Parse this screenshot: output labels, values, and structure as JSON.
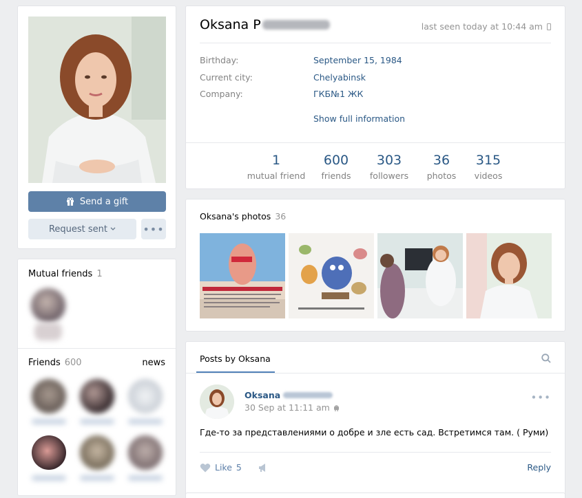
{
  "profile": {
    "name": "Oksana P",
    "last_seen": "last seen today at 10:44 am",
    "info": [
      {
        "label": "Birthday:",
        "value": "September 15, 1984"
      },
      {
        "label": "Current city:",
        "value": "Chelyabinsk"
      },
      {
        "label": "Company:",
        "value": "ГКБ№1 ЖК"
      }
    ],
    "show_full": "Show full information",
    "counters": [
      {
        "num": "1",
        "label": "mutual friend"
      },
      {
        "num": "600",
        "label": "friends"
      },
      {
        "num": "303",
        "label": "followers"
      },
      {
        "num": "36",
        "label": "photos"
      },
      {
        "num": "315",
        "label": "videos"
      }
    ]
  },
  "actions": {
    "gift": "Send a gift",
    "request": "Request sent"
  },
  "sidebar": {
    "mutual_title": "Mutual friends",
    "mutual_count": "1",
    "friends_title": "Friends",
    "friends_count": "600",
    "news_link": "news"
  },
  "photos": {
    "title": "Oksana's photos",
    "count": "36"
  },
  "posts": {
    "tab": "Posts by Oksana",
    "author": "Oksana",
    "date": "30 Sep at 11:11 am",
    "text": "Где-то за представлениями о добре и зле есть сад. Встретимся там. ( Руми)",
    "like_label": "Like",
    "like_count": "5",
    "reply": "Reply"
  },
  "colors": {
    "link": "#2a5885",
    "button": "#5e81a8",
    "background": "#edeef0"
  },
  "icons": [
    "gift-icon",
    "chevron-down-icon",
    "more-icon",
    "phone-icon",
    "search-icon",
    "android-icon",
    "heart-icon",
    "share-icon"
  ]
}
